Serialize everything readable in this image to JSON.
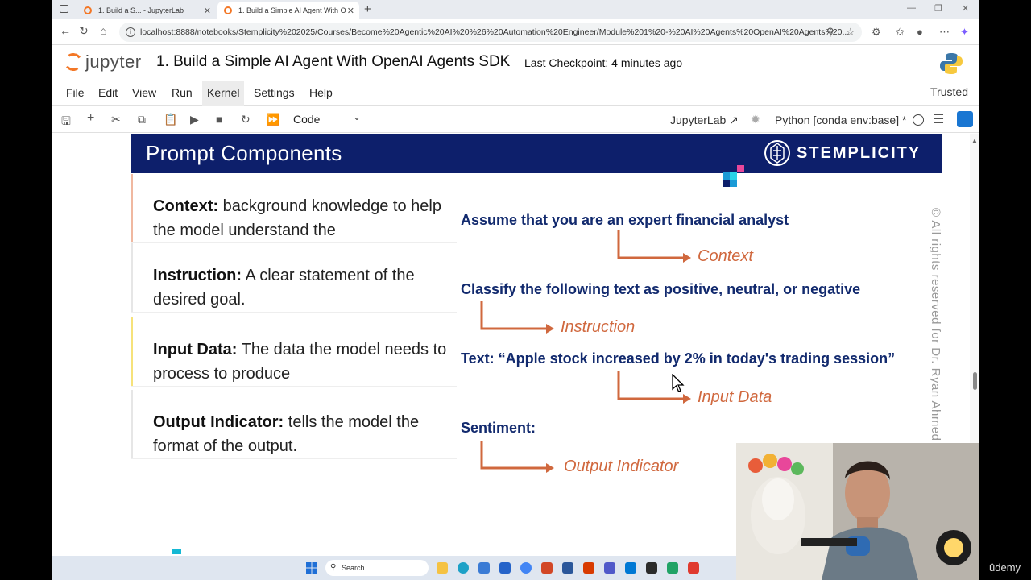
{
  "browser": {
    "tabs": [
      {
        "title": "1. Build a S... - JupyterLab"
      },
      {
        "title": "1. Build a Simple AI Agent With O"
      }
    ],
    "new_tab": "+",
    "url": "localhost:8888/notebooks/Stemplicity%202025/Courses/Become%20Agentic%20AI%20%26%20Automation%20Engineer/Module%201%20-%20AI%20Agents%20OpenAI%20Agents%20..."
  },
  "jupyter": {
    "logo_text": "jupyter",
    "notebook_title": "1. Build a Simple AI Agent With OpenAI Agents SDK",
    "checkpoint": "Last Checkpoint: 4 minutes ago",
    "menu": [
      "File",
      "Edit",
      "View",
      "Run",
      "Kernel",
      "Settings",
      "Help"
    ],
    "trusted": "Trusted",
    "cell_type": "Code",
    "jupyterlab_link": "JupyterLab",
    "kernel": "Python [conda env:base] *"
  },
  "slide": {
    "title": "Prompt Components",
    "brand": "STEMPLICITY",
    "components": [
      {
        "name": "Context:",
        "desc": "background knowledge to help the model understand the",
        "color": "#f0b8a0"
      },
      {
        "name": "Instruction:",
        "desc": "A clear statement of the desired goal.",
        "color": "#ffffff"
      },
      {
        "name": "Input Data:",
        "desc": "The data the model needs to process to produce",
        "color": "#f6e27a"
      },
      {
        "name": "Output Indicator:",
        "desc": "tells the model the format of the output.",
        "color": "#ffffff"
      }
    ],
    "examples": [
      {
        "text": "Assume that you are an expert financial analyst",
        "label": "Context"
      },
      {
        "text": "Classify the following text as positive, neutral, or negative",
        "label": "Instruction"
      },
      {
        "text": "Text: “Apple stock increased by 2% in today's trading session”",
        "label": "Input Data"
      },
      {
        "text": "Sentiment:",
        "label": "Output Indicator"
      }
    ],
    "copyright": "© All rights reserved for Dr. Ryan Ahmed"
  },
  "taskbar": {
    "search": "Search"
  },
  "watermark": "ûdemy"
}
